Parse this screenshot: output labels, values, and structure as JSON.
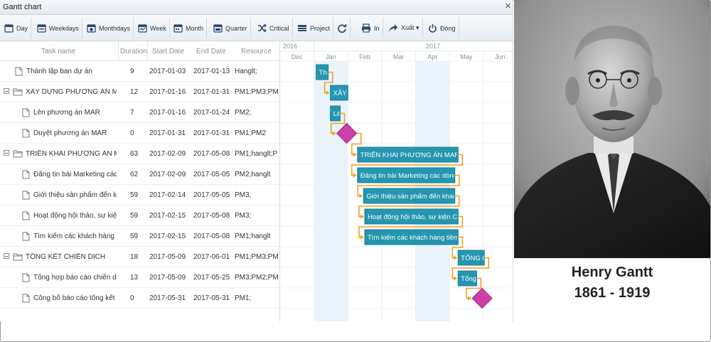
{
  "window": {
    "title": "Gantt chart",
    "close_glyph": "✕"
  },
  "toolbar": {
    "day": "Day",
    "weekdays": "Weekdays",
    "monthdays": "Monthdays",
    "week": "Week",
    "month": "Month",
    "quarter": "Quarter",
    "critical": "Critical",
    "project": "Project",
    "print": "In",
    "export": "Xuất ▾",
    "close": "Đóng",
    "icons": [
      "calendar-day-icon",
      "calendar-weekdays-icon",
      "calendar-monthdays-icon",
      "calendar-week-icon",
      "calendar-month-icon",
      "calendar-quarter-icon",
      "shuffle-icon",
      "project-icon",
      "refresh-icon",
      "printer-icon",
      "share-icon",
      "power-icon"
    ]
  },
  "grid": {
    "columns": [
      "Task name",
      "Duration",
      "Start Date",
      "End Date",
      "Resource"
    ],
    "rows": [
      {
        "name": "Thành lập ban dự án",
        "duration": "9",
        "start": "2017-01-03",
        "end": "2017-01-13",
        "resource": "Hanglt;",
        "level": 1,
        "type": "task"
      },
      {
        "name": "XÂY DỰNG PHƯƠNG ÁN MA",
        "duration": "12",
        "start": "2017-01-16",
        "end": "2017-01-31",
        "resource": "PM1;PM3;PM",
        "level": 0,
        "type": "group"
      },
      {
        "name": "Lên phương án MAR",
        "duration": "7",
        "start": "2017-01-16",
        "end": "2017-01-24",
        "resource": "PM2;",
        "level": 2,
        "type": "task"
      },
      {
        "name": "Duyệt phương án MAR",
        "duration": "0",
        "start": "2017-01-31",
        "end": "2017-01-31",
        "resource": "PM1;PM2",
        "level": 2,
        "type": "task"
      },
      {
        "name": "TRIỂN KHAI PHƯƠNG ÁN MA",
        "duration": "63",
        "start": "2017-02-09",
        "end": "2017-05-08",
        "resource": "PM1;hanglt;P",
        "level": 0,
        "type": "group"
      },
      {
        "name": "Đăng tin bài Marketing các",
        "duration": "62",
        "start": "2017-02-09",
        "end": "2017-05-05",
        "resource": "PM2;hanglt",
        "level": 2,
        "type": "task"
      },
      {
        "name": "Giới thiệu sản phẩm đến kh",
        "duration": "59",
        "start": "2017-02-14",
        "end": "2017-05-05",
        "resource": "PM3;",
        "level": 2,
        "type": "task"
      },
      {
        "name": "Hoạt động hội thảo, sự kiện",
        "duration": "59",
        "start": "2017-02-15",
        "end": "2017-05-08",
        "resource": "PM3;",
        "level": 2,
        "type": "task"
      },
      {
        "name": "Tìm kiếm các khách hàng t",
        "duration": "59",
        "start": "2017-02-15",
        "end": "2017-05-08",
        "resource": "PM1;hanglt",
        "level": 2,
        "type": "task"
      },
      {
        "name": "TỔNG KẾT CHIẾN DỊCH",
        "duration": "18",
        "start": "2017-05-09",
        "end": "2017-06-01",
        "resource": "PM1;PM3;PM",
        "level": 0,
        "type": "group"
      },
      {
        "name": "Tổng hợp báo cáo chiến dịc",
        "duration": "13",
        "start": "2017-05-09",
        "end": "2017-05-25",
        "resource": "PM3;PM2;PM",
        "level": 2,
        "type": "task"
      },
      {
        "name": "Công bố báo cáo tổng kết",
        "duration": "0",
        "start": "2017-05-31",
        "end": "2017-05-31",
        "resource": "PM1;",
        "level": 2,
        "type": "task"
      }
    ]
  },
  "timeline": {
    "years": [
      "2016",
      "2017"
    ],
    "months": [
      "Dec",
      "Jan",
      "Feb",
      "Mar",
      "Apr",
      "May",
      "Jun"
    ],
    "bars": [
      {
        "label": "Thành lập ban dự án",
        "start": "2017-01-03",
        "end": "2017-01-13",
        "milestone": false
      },
      {
        "label": "XÂY DỰNG PHƯƠNG ÁN MAR",
        "start": "2017-01-16",
        "end": "2017-01-31",
        "milestone": false
      },
      {
        "label": "Lên phương án MAR",
        "start": "2017-01-16",
        "end": "2017-01-24",
        "milestone": false
      },
      {
        "label": "",
        "start": "2017-01-31",
        "end": "2017-01-31",
        "milestone": true
      },
      {
        "label": "TRIỂN KHAI PHƯƠNG ÁN MAR",
        "start": "2017-02-09",
        "end": "2017-05-08",
        "milestone": false
      },
      {
        "label": "Đăng tin bài Marketing các dòng",
        "start": "2017-02-09",
        "end": "2017-05-05",
        "milestone": false
      },
      {
        "label": "Giới thiệu sản phẩm đến khách",
        "start": "2017-02-14",
        "end": "2017-05-05",
        "milestone": false
      },
      {
        "label": "Hoạt động hội thảo, sự kiện CN",
        "start": "2017-02-15",
        "end": "2017-05-08",
        "milestone": false
      },
      {
        "label": "Tìm kiếm các khách hàng tiềm n",
        "start": "2017-02-15",
        "end": "2017-05-08",
        "milestone": false
      },
      {
        "label": "TỔNG KẾT CHIẾN DỊCH",
        "start": "2017-05-09",
        "end": "2017-06-01",
        "milestone": false
      },
      {
        "label": "Tổng hợp báo cáo chiến dịch",
        "start": "2017-05-09",
        "end": "2017-05-25",
        "milestone": false
      },
      {
        "label": "",
        "start": "2017-05-31",
        "end": "2017-05-31",
        "milestone": true
      }
    ],
    "colors": {
      "bar": "#2596b0",
      "bar_dark": "#1b7d95",
      "milestone": "#cc3fa8",
      "link": "#f0a020",
      "shade": "#eaf2fb"
    }
  },
  "caption": {
    "name": "Henry Gantt",
    "years": "1861 - 1919"
  }
}
